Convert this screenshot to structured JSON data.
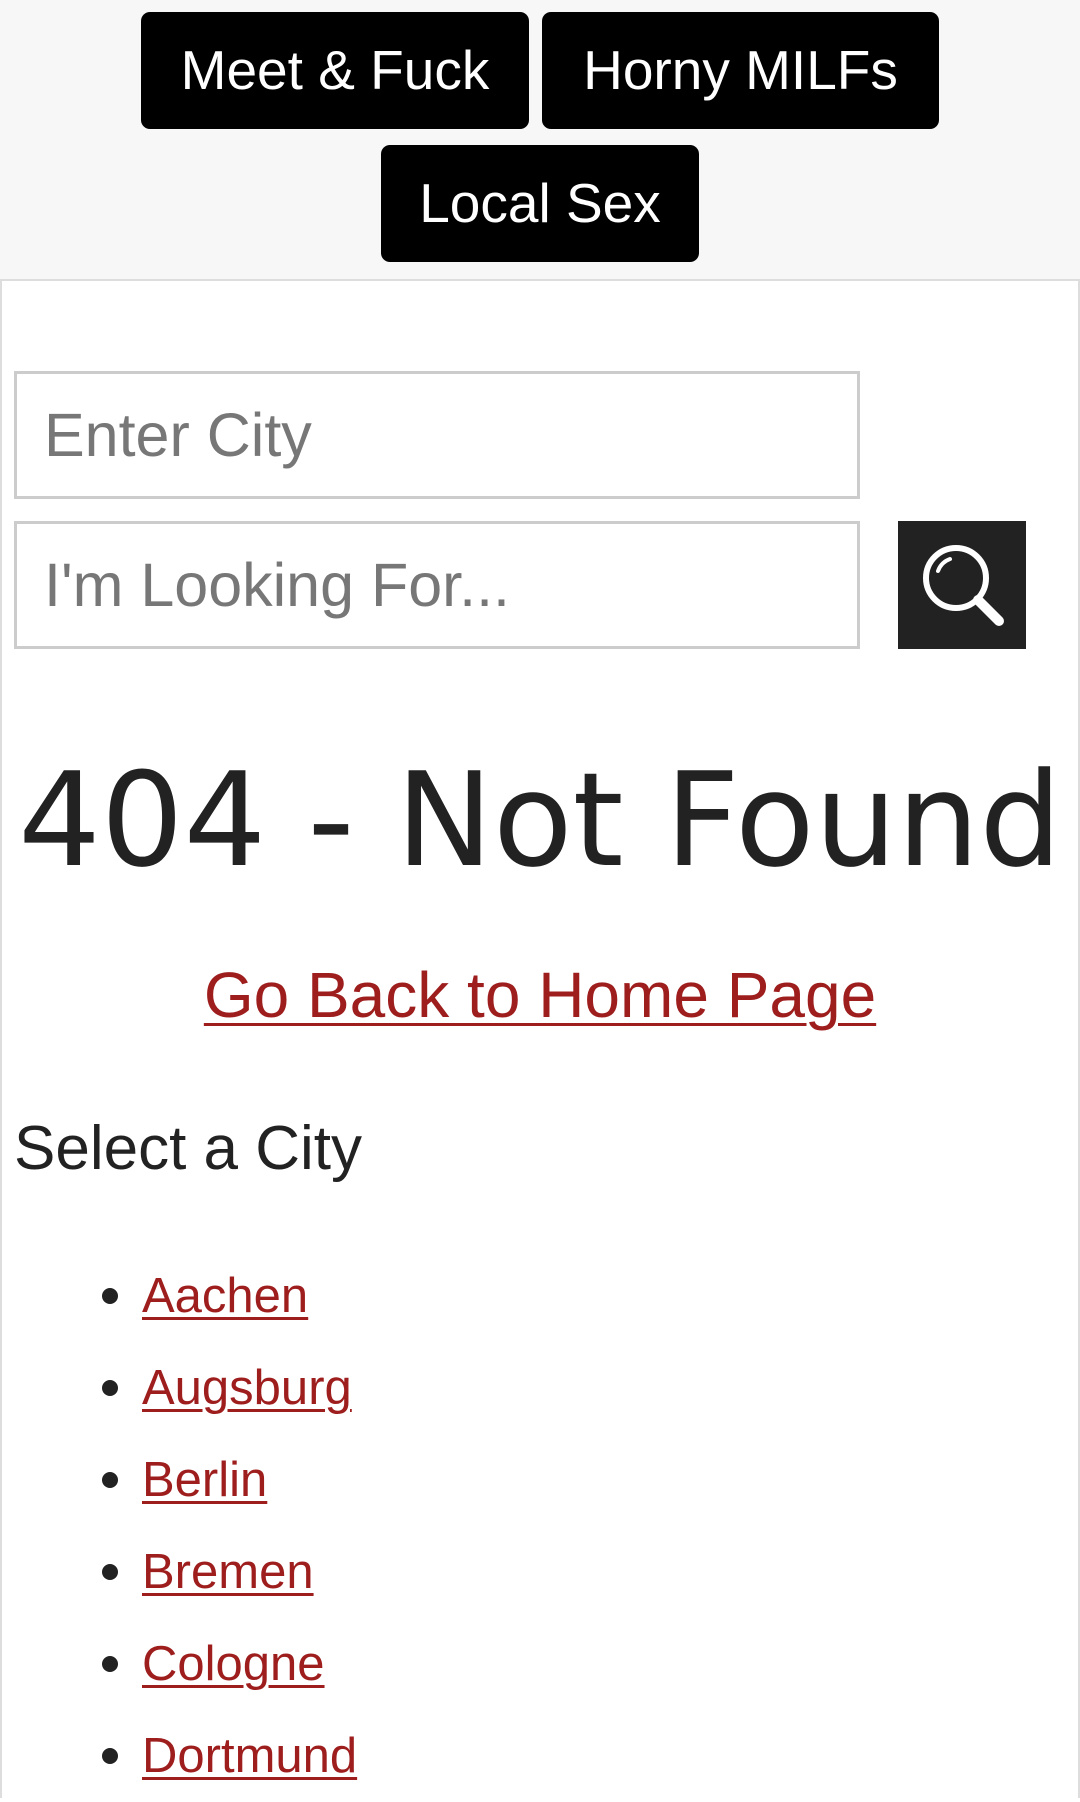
{
  "nav": {
    "buttons": [
      {
        "label": "Meet & Fuck"
      },
      {
        "label": "Horny MILFs"
      },
      {
        "label": "Local Sex"
      }
    ]
  },
  "search": {
    "city_placeholder": "Enter City",
    "looking_placeholder": "I'm Looking For...",
    "button_icon": "search-icon"
  },
  "error": {
    "title": "404 - Not Found",
    "home_link": "Go Back to Home Page"
  },
  "cities": {
    "heading": "Select a City",
    "items": [
      {
        "label": "Aachen"
      },
      {
        "label": "Augsburg"
      },
      {
        "label": "Berlin"
      },
      {
        "label": "Bremen"
      },
      {
        "label": "Cologne"
      },
      {
        "label": "Dortmund"
      }
    ]
  },
  "colors": {
    "link": "#9e1d1d",
    "nav_button_bg": "#000000",
    "search_button_bg": "#222222",
    "header_bg": "#f7f7f7"
  }
}
